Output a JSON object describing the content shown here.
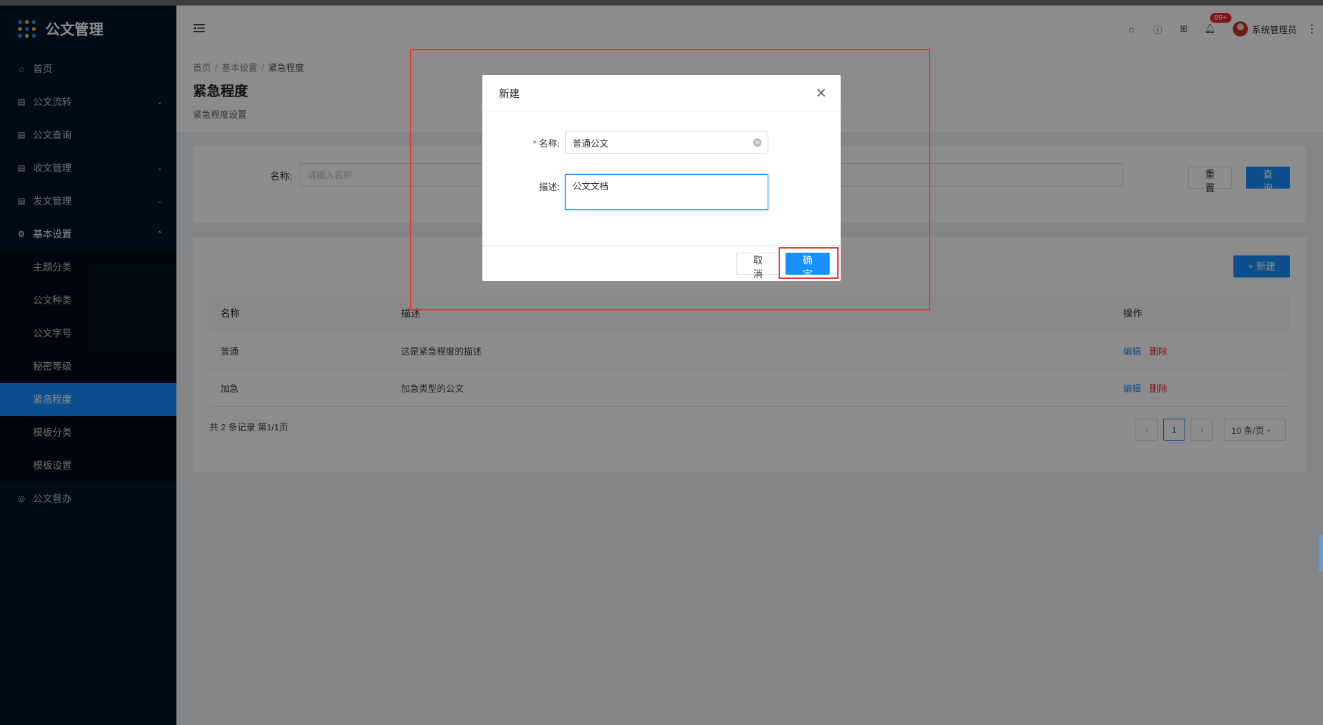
{
  "app": {
    "title": "公文管理"
  },
  "sidebar": {
    "items": [
      {
        "label": "首页",
        "icon": "home-icon"
      },
      {
        "label": "公文流转",
        "icon": "document-icon"
      },
      {
        "label": "公文查询",
        "icon": "document-icon"
      },
      {
        "label": "收文管理",
        "icon": "document-icon"
      },
      {
        "label": "发文管理",
        "icon": "document-icon"
      },
      {
        "label": "基本设置",
        "icon": "gear-icon"
      },
      {
        "label": "公文督办",
        "icon": "shield-icon"
      }
    ],
    "sub_items": [
      {
        "label": "主题分类"
      },
      {
        "label": "公文种类"
      },
      {
        "label": "公文字号"
      },
      {
        "label": "秘密等级"
      },
      {
        "label": "紧急程度"
      },
      {
        "label": "模板分类"
      },
      {
        "label": "模板设置"
      }
    ]
  },
  "header": {
    "badge": "99+",
    "username": "系统管理员"
  },
  "breadcrumb": {
    "items": [
      "首页",
      "基本设置",
      "紧急程度"
    ]
  },
  "page": {
    "title": "紧急程度",
    "subtitle": "紧急程度设置"
  },
  "search": {
    "label": "名称:",
    "placeholder": "请输入名称",
    "reset_label": "重 置",
    "query_label": "查 询"
  },
  "table": {
    "new_label": "+ 新建",
    "columns": [
      "名称",
      "描述",
      "操作"
    ],
    "rows": [
      {
        "name": "普通",
        "desc": "这是紧急程度的描述",
        "edit": "编辑",
        "delete": "删除"
      },
      {
        "name": "加急",
        "desc": "加急类型的公文",
        "edit": "编辑",
        "delete": "删除"
      }
    ],
    "total": "共 2 条记录 第1/1页",
    "current_page": "1",
    "page_size": "10 条/页"
  },
  "modal": {
    "title": "新建",
    "name_label": "名称:",
    "name_value": "普通公文",
    "desc_label": "描述:",
    "desc_value": "公文文档",
    "cancel_label": "取 消",
    "ok_label": "确 定"
  },
  "colors": {
    "primary": "#1890ff",
    "sidebar_bg": "#001529",
    "danger": "#f5222d",
    "annotation": "#e53935"
  }
}
